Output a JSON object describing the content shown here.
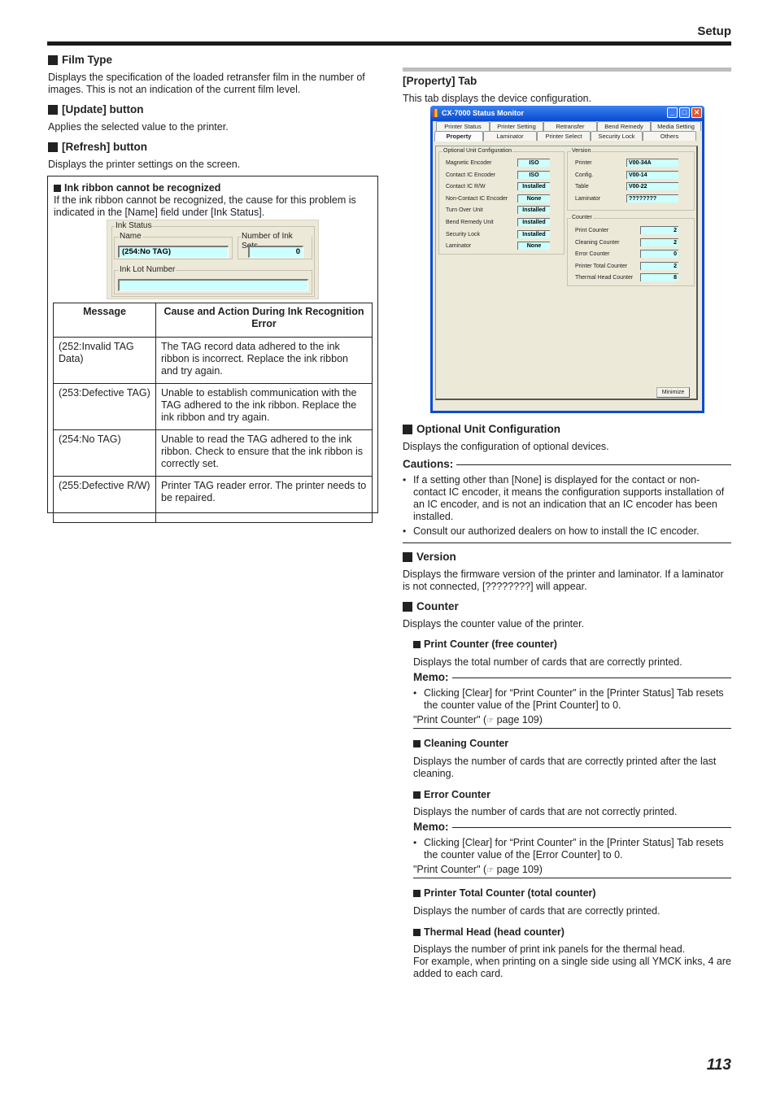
{
  "header": {
    "section": "Setup"
  },
  "page_number": "113",
  "left": {
    "film_type": {
      "title": "Film Type",
      "text": "Displays the specification of the loaded retransfer film in the number of images. This is not an indication of the current film level."
    },
    "update_button": {
      "title": "[Update] button",
      "text": "Applies the selected value to the printer."
    },
    "refresh_button": {
      "title": "[Refresh] button",
      "text": "Displays the printer settings on the screen."
    },
    "note": {
      "title": "Ink ribbon cannot be recognized",
      "text": "If the ink ribbon cannot be recognized, the cause for this problem is indicated in the [Name] field under [Ink Status].",
      "ink_status": {
        "group_label": "Ink Status",
        "name_label": "Name",
        "name_value": "(254:No TAG)",
        "ink_sets_label": "Number of Ink Sets",
        "ink_sets_value": "0",
        "lot_label": "Ink Lot Number",
        "lot_value": ""
      },
      "table": {
        "headers": [
          "Message",
          "Cause and Action During Ink Recognition Error"
        ],
        "rows": [
          [
            "(252:Invalid TAG Data)",
            "The TAG record data adhered to the ink ribbon is incorrect. Replace the ink ribbon and try again."
          ],
          [
            "(253:Defective TAG)",
            "Unable to establish communication with the TAG adhered to the ink ribbon. Replace the ink ribbon and try again."
          ],
          [
            "(254:No TAG)",
            "Unable to read the TAG adhered to the ink ribbon. Check to ensure that the ink ribbon is correctly set."
          ],
          [
            "(255:Defective R/W)",
            "Printer TAG reader error. The printer needs to be repaired."
          ]
        ]
      }
    }
  },
  "right": {
    "property_tab": {
      "title": "[Property] Tab",
      "text": "This tab displays the device configuration."
    },
    "window": {
      "title": "CX-7000 Status Monitor",
      "controls": {
        "minimize": "_",
        "maximize": "□",
        "close": "✕"
      },
      "tabs_row1": [
        "Printer Status",
        "Printer Setting",
        "Retransfer",
        "Bend Remedy",
        "Media Setting"
      ],
      "tabs_row2": [
        "Property",
        "Laminator",
        "Printer Select",
        "Security Lock",
        "Others"
      ],
      "active_tab": "Property",
      "optional_unit": {
        "label": "Optional Unit Configuration",
        "rows": [
          {
            "label": "Magnetic Encoder",
            "value": "ISO"
          },
          {
            "label": "Contact IC Encoder",
            "value": "ISO"
          },
          {
            "label": "Contact IC R/W",
            "value": "Installed"
          },
          {
            "label": "Non-Contact IC Encoder",
            "value": "None"
          },
          {
            "label": "Turn Over Unit",
            "value": "Installed"
          },
          {
            "label": "Bend Remedy Unit",
            "value": "Installed"
          },
          {
            "label": "Security Lock",
            "value": "Installed"
          },
          {
            "label": "Laminator",
            "value": "None"
          }
        ]
      },
      "version": {
        "label": "Version",
        "rows": [
          {
            "label": "Printer",
            "value": "V00-34A"
          },
          {
            "label": "Config.",
            "value": "V00-14"
          },
          {
            "label": "Table",
            "value": "V00-22"
          },
          {
            "label": "Laminator",
            "value": "????????"
          }
        ]
      },
      "counter": {
        "label": "Counter",
        "rows": [
          {
            "label": "Print Counter",
            "value": "2"
          },
          {
            "label": "Cleaning Counter",
            "value": "2"
          },
          {
            "label": "Error Counter",
            "value": "0"
          },
          {
            "label": "Printer Total Counter",
            "value": "2"
          },
          {
            "label": "Thermal Head Counter",
            "value": "8"
          }
        ]
      },
      "minimize_button": "Minimize"
    },
    "optional_unit_config": {
      "title": "Optional Unit Configuration",
      "text": "Displays the configuration of optional devices."
    },
    "cautions": {
      "label": "Cautions:",
      "items": [
        "If a setting other than [None] is displayed for the contact or non-contact IC encoder, it means the configuration supports installation of an IC encoder, and is not an indication that an IC encoder has been installed.",
        "Consult our authorized dealers on how to install the IC encoder."
      ]
    },
    "version": {
      "title": "Version",
      "text": "Displays the firmware version of the printer and laminator. If a laminator is not connected, [????????] will appear."
    },
    "counter": {
      "title": "Counter",
      "text": "Displays the counter value of the printer."
    },
    "print_counter": {
      "title": "Print Counter (free counter)",
      "text": "Displays the total number of cards that are correctly printed.",
      "memo_label": "Memo:",
      "memo_item": "Clicking [Clear] for “Print Counter” in the [Printer Status] Tab resets the counter value of the [Print Counter] to 0.",
      "ref_text": "\"Print Counter\" (",
      "ref_icon": "☞",
      "ref_page": " page 109)"
    },
    "cleaning_counter": {
      "title": "Cleaning Counter",
      "text": "Displays the number of cards that are correctly printed after the last cleaning."
    },
    "error_counter": {
      "title": "Error Counter",
      "text": "Displays the number of cards that are not correctly printed.",
      "memo_label": "Memo:",
      "memo_item": "Clicking [Clear] for “Print Counter” in the [Printer Status] Tab resets the counter value of the [Error Counter] to 0.",
      "ref_text": "\"Print Counter\" (",
      "ref_icon": "☞",
      "ref_page": " page 109)"
    },
    "printer_total_counter": {
      "title": "Printer Total Counter (total counter)",
      "text": "Displays the number of cards that are correctly printed."
    },
    "thermal_head": {
      "title": "Thermal Head (head counter)",
      "text": "Displays the number of print ink panels for the thermal head.",
      "text2": "For example, when printing on a single side using all YMCK inks, 4 are added to each card."
    }
  }
}
